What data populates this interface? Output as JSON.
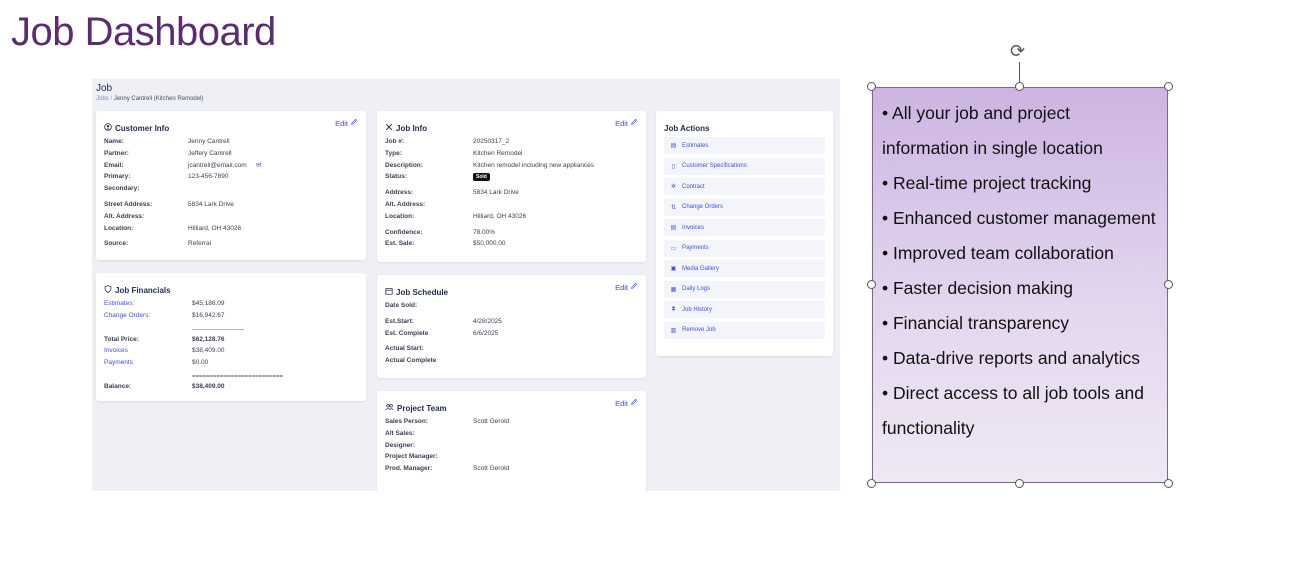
{
  "slide": {
    "title": "Job Dashboard"
  },
  "app": {
    "title": "Job",
    "breadcrumb": {
      "root": "Jobs",
      "sep": "/",
      "current": "Jenny Cantrell (Kitchen Remodel)"
    }
  },
  "customer_info": {
    "title": "Customer Info",
    "edit": "Edit",
    "rows": [
      {
        "label": "Name:",
        "value": "Jenny Cantrell"
      },
      {
        "label": "Partner:",
        "value": "Jeffery Cantrell"
      },
      {
        "label": "Email:",
        "value": "jcantrell@email.com"
      },
      {
        "label": "Primary:",
        "value": "123-456-7890"
      },
      {
        "label": "Secondary:",
        "value": ""
      },
      {
        "label": "Street Address:",
        "value": "5834 Lark Drive"
      },
      {
        "label": "Alt. Address:",
        "value": ""
      },
      {
        "label": "Location:",
        "value": "Hilliard, OH 43026"
      },
      {
        "label": "Source:",
        "value": "Referral"
      }
    ]
  },
  "job_financials": {
    "title": "Job Financials",
    "rows": [
      {
        "label": "Estimates:",
        "value": "$45,186.09"
      },
      {
        "label": "Change Orders:",
        "value": "$16,942.67"
      },
      {
        "label": "Total Price:",
        "value": "$62,128.76"
      },
      {
        "label": "Invoices",
        "value": "$38,409.00"
      },
      {
        "label": "Payments",
        "value": "$0.00"
      },
      {
        "label": "Balance:",
        "value": "$38,409.00"
      }
    ],
    "divider_short": "--------------------------",
    "divider_long": "=========================="
  },
  "job_info": {
    "title": "Job Info",
    "edit": "Edit",
    "rows": [
      {
        "label": "Job #:",
        "value": "20250317_2"
      },
      {
        "label": "Type:",
        "value": "Kitchen Remodel"
      },
      {
        "label": "Description:",
        "value": "Kitchen remodel including new appliances"
      },
      {
        "label": "Status:",
        "value": "Sold"
      },
      {
        "label": "Address:",
        "value": "5834 Lark Drive"
      },
      {
        "label": "Alt. Address:",
        "value": ""
      },
      {
        "label": "Location:",
        "value": "Hilliard, OH 43026"
      },
      {
        "label": "Confidence:",
        "value": "78.00%"
      },
      {
        "label": "Est. Sale:",
        "value": "$50,000.00"
      }
    ]
  },
  "job_schedule": {
    "title": "Job Schedule",
    "edit": "Edit",
    "rows": [
      {
        "label": "Date Sold:",
        "value": ""
      },
      {
        "label": "Est.Start:",
        "value": "4/28/2025"
      },
      {
        "label": "Est. Complete",
        "value": "6/6/2025"
      },
      {
        "label": "Actual Start:",
        "value": ""
      },
      {
        "label": "Actual Complete",
        "value": ""
      }
    ]
  },
  "project_team": {
    "title": "Project Team",
    "edit": "Edit",
    "rows": [
      {
        "label": "Sales Person:",
        "value": "Scott Gerold"
      },
      {
        "label": "Alt Sales:",
        "value": ""
      },
      {
        "label": "Designer:",
        "value": ""
      },
      {
        "label": "Project Manager:",
        "value": ""
      },
      {
        "label": "Prod. Manager:",
        "value": "Scott Gerold"
      }
    ]
  },
  "job_actions": {
    "title": "Job Actions",
    "items": [
      {
        "label": "Estimates",
        "icon": "document-icon",
        "glyph": "▤"
      },
      {
        "label": "Customer Specifications",
        "icon": "file-icon",
        "glyph": "▯"
      },
      {
        "label": "Contract",
        "icon": "contract-icon",
        "glyph": "✲"
      },
      {
        "label": "Change Orders",
        "icon": "swap-icon",
        "glyph": "⇅"
      },
      {
        "label": "Invoices",
        "icon": "invoice-icon",
        "glyph": "▤"
      },
      {
        "label": "Payments",
        "icon": "card-icon",
        "glyph": "▭"
      },
      {
        "label": "Media Gallery",
        "icon": "image-icon",
        "glyph": "▣"
      },
      {
        "label": "Daily Logs",
        "icon": "calendar-icon",
        "glyph": "▦"
      },
      {
        "label": "Job History",
        "icon": "hourglass-icon",
        "glyph": "⧗"
      },
      {
        "label": "Remove Job",
        "icon": "trash-icon",
        "glyph": "▥"
      }
    ]
  },
  "bullets": [
    "• All your job and project information in single location",
    "• Real-time project tracking",
    "• Enhanced customer management",
    "• Improved team collaboration",
    "• Faster decision making",
    "• Financial transparency",
    "• Data-drive reports and analytics",
    "• Direct access to all job tools and functionality"
  ]
}
